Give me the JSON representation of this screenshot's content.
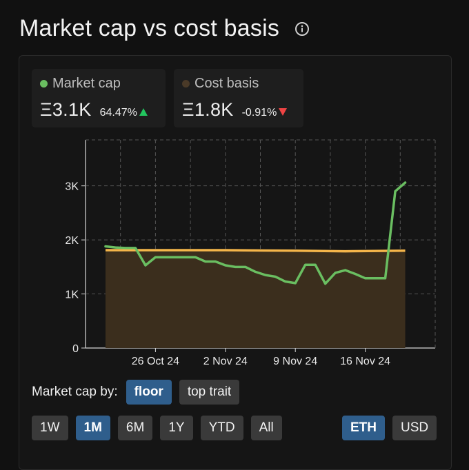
{
  "header": {
    "title": "Market cap vs cost basis"
  },
  "stats": {
    "market_cap": {
      "label": "Market cap",
      "value": "Ξ3.1K",
      "change": "64.47%",
      "direction": "up",
      "color": "#6abe61"
    },
    "cost_basis": {
      "label": "Cost basis",
      "value": "Ξ1.8K",
      "change": "-0.91%",
      "direction": "down",
      "color": "#4a3a28"
    }
  },
  "controls": {
    "market_cap_by_label": "Market cap by:",
    "market_cap_by_options": [
      {
        "label": "floor",
        "active": true
      },
      {
        "label": "top trait",
        "active": false
      }
    ],
    "ranges": [
      {
        "label": "1W",
        "active": false
      },
      {
        "label": "1M",
        "active": true
      },
      {
        "label": "6M",
        "active": false
      },
      {
        "label": "1Y",
        "active": false
      },
      {
        "label": "YTD",
        "active": false
      },
      {
        "label": "All",
        "active": false
      }
    ],
    "currencies": [
      {
        "label": "ETH",
        "active": true
      },
      {
        "label": "USD",
        "active": false
      }
    ]
  },
  "colors": {
    "market_cap_line": "#6abe61",
    "cost_basis_line": "#f4b54a",
    "cost_basis_fill": "#3b2e1d",
    "active_button": "#2f5e8c",
    "inactive_button": "#3a3a3a",
    "grid": "#555555"
  },
  "chart_data": {
    "type": "line",
    "x_tick_labels": [
      "26 Oct 24",
      "2 Nov 24",
      "9 Nov 24",
      "16 Nov 24"
    ],
    "x_tick_dates": [
      "2024-10-26",
      "2024-11-02",
      "2024-11-09",
      "2024-11-16"
    ],
    "x_range": [
      "2024-10-19",
      "2024-11-23"
    ],
    "y_tick_labels": [
      "0",
      "1K",
      "2K",
      "3K"
    ],
    "y_ticks": [
      0,
      1000,
      2000,
      3000
    ],
    "ylim": [
      0,
      3850
    ],
    "grid": true,
    "series": [
      {
        "name": "Market cap",
        "style": "line",
        "points": [
          {
            "x": "2024-10-21",
            "y": 1880
          },
          {
            "x": "2024-10-22",
            "y": 1860
          },
          {
            "x": "2024-10-23",
            "y": 1850
          },
          {
            "x": "2024-10-24",
            "y": 1850
          },
          {
            "x": "2024-10-25",
            "y": 1530
          },
          {
            "x": "2024-10-26",
            "y": 1680
          },
          {
            "x": "2024-10-27",
            "y": 1680
          },
          {
            "x": "2024-10-28",
            "y": 1680
          },
          {
            "x": "2024-10-29",
            "y": 1680
          },
          {
            "x": "2024-10-30",
            "y": 1680
          },
          {
            "x": "2024-10-31",
            "y": 1600
          },
          {
            "x": "2024-11-01",
            "y": 1600
          },
          {
            "x": "2024-11-02",
            "y": 1530
          },
          {
            "x": "2024-11-03",
            "y": 1500
          },
          {
            "x": "2024-11-04",
            "y": 1500
          },
          {
            "x": "2024-11-05",
            "y": 1410
          },
          {
            "x": "2024-11-06",
            "y": 1350
          },
          {
            "x": "2024-11-07",
            "y": 1320
          },
          {
            "x": "2024-11-08",
            "y": 1230
          },
          {
            "x": "2024-11-09",
            "y": 1200
          },
          {
            "x": "2024-11-10",
            "y": 1540
          },
          {
            "x": "2024-11-11",
            "y": 1540
          },
          {
            "x": "2024-11-12",
            "y": 1190
          },
          {
            "x": "2024-11-13",
            "y": 1390
          },
          {
            "x": "2024-11-14",
            "y": 1440
          },
          {
            "x": "2024-11-15",
            "y": 1370
          },
          {
            "x": "2024-11-16",
            "y": 1290
          },
          {
            "x": "2024-11-17",
            "y": 1290
          },
          {
            "x": "2024-11-18",
            "y": 1290
          },
          {
            "x": "2024-11-19",
            "y": 2900
          },
          {
            "x": "2024-11-20",
            "y": 3060
          }
        ]
      },
      {
        "name": "Cost basis",
        "style": "area",
        "points": [
          {
            "x": "2024-10-21",
            "y": 1810
          },
          {
            "x": "2024-10-27",
            "y": 1810
          },
          {
            "x": "2024-11-02",
            "y": 1810
          },
          {
            "x": "2024-11-09",
            "y": 1800
          },
          {
            "x": "2024-11-14",
            "y": 1790
          },
          {
            "x": "2024-11-20",
            "y": 1800
          }
        ]
      }
    ]
  }
}
